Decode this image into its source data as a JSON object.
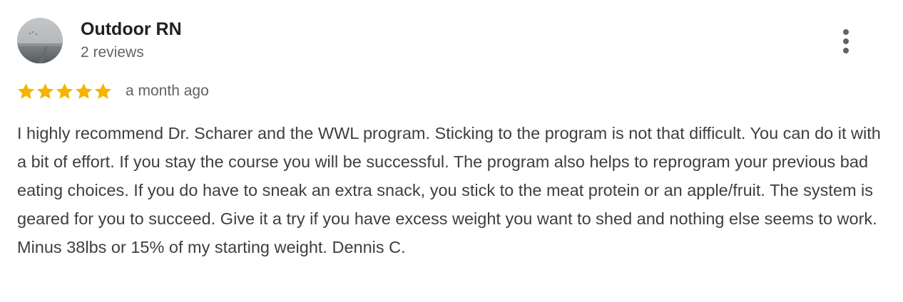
{
  "reviewer": {
    "name": "Outdoor RN",
    "reviews_count": "2 reviews"
  },
  "rating": {
    "stars": 5,
    "max_stars": 5,
    "star_color": "#f4b400",
    "time_ago": "a month ago"
  },
  "review": {
    "text": "I highly recommend Dr. Scharer and the WWL program. Sticking to the program is not that difficult. You can do it with a bit of effort. If you stay the course you will be successful. The program also helps to reprogram your previous bad eating choices. If you do have to sneak an extra snack, you stick to the meat protein or an apple/fruit. The system is geared for you to succeed. Give it a try if you have excess weight you want to shed and nothing else seems to work. Minus 38lbs or 15% of my starting weight. Dennis C."
  },
  "icons": {
    "more": "more-vert-icon",
    "star": "star-icon"
  }
}
